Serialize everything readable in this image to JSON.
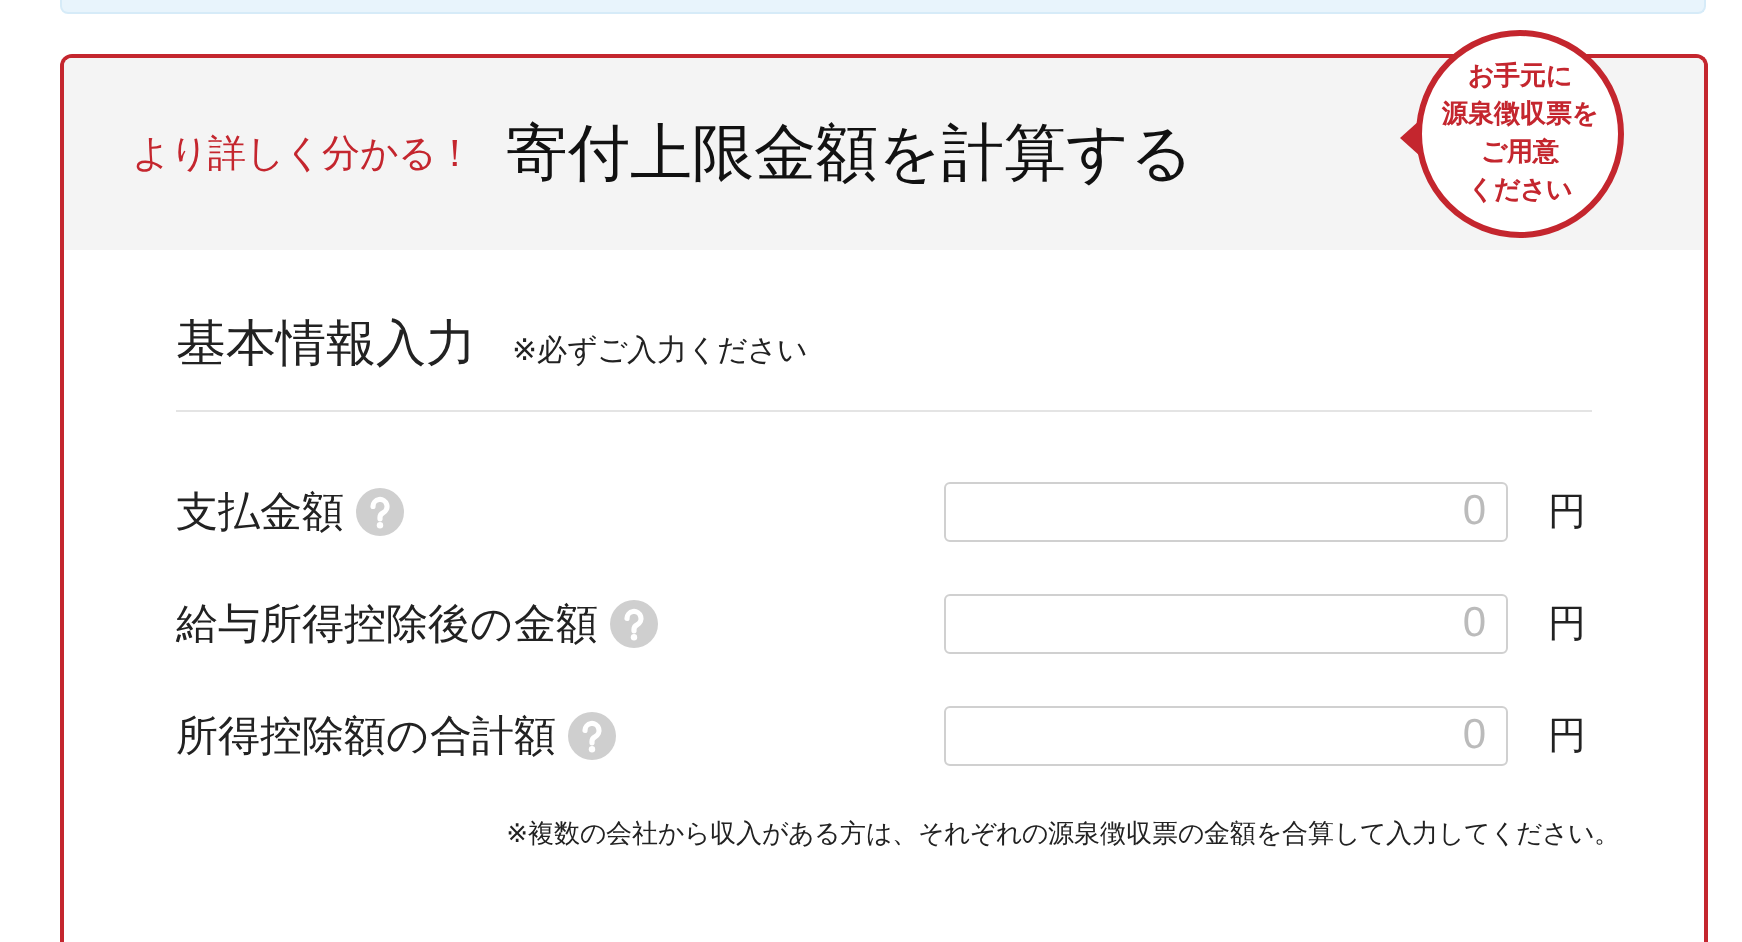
{
  "header": {
    "lead": "より詳しく分かる！",
    "title": "寄付上限金額を計算する",
    "bubble_lines": [
      "お手元に",
      "源泉徴収票を",
      "ご用意",
      "ください"
    ]
  },
  "section": {
    "title": "基本情報入力",
    "note": "※必ずご入力ください"
  },
  "fields": [
    {
      "label": "支払金額",
      "placeholder": "0",
      "unit": "円"
    },
    {
      "label": "給与所得控除後の金額",
      "placeholder": "0",
      "unit": "円"
    },
    {
      "label": "所得控除額の合計額",
      "placeholder": "0",
      "unit": "円"
    }
  ],
  "footnote": "※複数の会社から収入がある方は、それぞれの源泉徴収票の金額を合算して入力してください。"
}
